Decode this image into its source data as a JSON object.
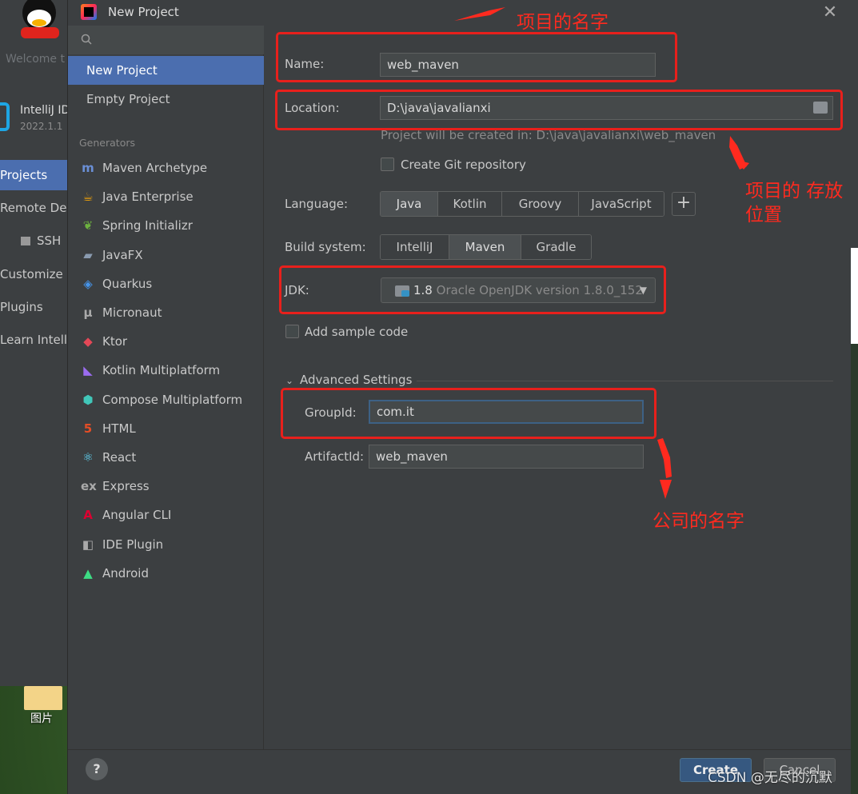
{
  "desktop": {
    "icon_label": "图片"
  },
  "welcome_window": {
    "title": "Welcome t",
    "app_name": "IntelliJ ID",
    "app_version": "2022.1.1",
    "nav": [
      {
        "label": "Projects",
        "selected": true
      },
      {
        "label": "Remote Dev",
        "selected": false
      },
      {
        "label": "SSH",
        "selected": false
      },
      {
        "label": "Customize",
        "selected": false
      },
      {
        "label": "Plugins",
        "selected": false
      },
      {
        "label": "Learn Intelli",
        "selected": false
      }
    ]
  },
  "dialog": {
    "title": "New Project",
    "close_glyph": "✕",
    "left_panel": {
      "search_placeholder": "",
      "items": [
        {
          "label": "New Project",
          "selected": true
        },
        {
          "label": "Empty Project",
          "selected": false
        }
      ],
      "generators_header": "Generators",
      "generators": [
        {
          "label": "Maven Archetype",
          "icon": "maven-icon",
          "glyph": "m",
          "color": "#6a8fd6"
        },
        {
          "label": "Java Enterprise",
          "icon": "java-enterprise-icon",
          "glyph": "☕",
          "color": "#f0a30a"
        },
        {
          "label": "Spring Initializr",
          "icon": "spring-icon",
          "glyph": "❦",
          "color": "#6db33f"
        },
        {
          "label": "JavaFX",
          "icon": "javafx-icon",
          "glyph": "▰",
          "color": "#8a9bb0"
        },
        {
          "label": "Quarkus",
          "icon": "quarkus-icon",
          "glyph": "◈",
          "color": "#4695eb"
        },
        {
          "label": "Micronaut",
          "icon": "micronaut-icon",
          "glyph": "μ",
          "color": "#aaaaaa"
        },
        {
          "label": "Ktor",
          "icon": "ktor-icon",
          "glyph": "◆",
          "color": "#e44857"
        },
        {
          "label": "Kotlin Multiplatform",
          "icon": "kotlin-icon",
          "glyph": "◣",
          "color": "#9b6cf0"
        },
        {
          "label": "Compose Multiplatform",
          "icon": "compose-icon",
          "glyph": "⬢",
          "color": "#41c7b9"
        },
        {
          "label": "HTML",
          "icon": "html-icon",
          "glyph": "5",
          "color": "#e44d26"
        },
        {
          "label": "React",
          "icon": "react-icon",
          "glyph": "⚛",
          "color": "#61dafb"
        },
        {
          "label": "Express",
          "icon": "express-icon",
          "glyph": "ex",
          "color": "#aaaaaa"
        },
        {
          "label": "Angular CLI",
          "icon": "angular-icon",
          "glyph": "A",
          "color": "#dd0031"
        },
        {
          "label": "IDE Plugin",
          "icon": "ide-plugin-icon",
          "glyph": "◧",
          "color": "#aaaaaa"
        },
        {
          "label": "Android",
          "icon": "android-icon",
          "glyph": "▲",
          "color": "#3ddc84"
        }
      ]
    },
    "form": {
      "name_label": "Name:",
      "name_value": "web_maven",
      "location_label": "Location:",
      "location_value": "D:\\java\\javalianxi",
      "location_hint": "Project will be created in: D:\\java\\javalianxi\\web_maven",
      "git_label": "Create Git repository",
      "git_checked": false,
      "language_label": "Language:",
      "languages": [
        {
          "label": "Java",
          "selected": true
        },
        {
          "label": "Kotlin",
          "selected": false
        },
        {
          "label": "Groovy",
          "selected": false
        },
        {
          "label": "JavaScript",
          "selected": false
        }
      ],
      "add_language_glyph": "+",
      "build_label": "Build system:",
      "build_systems": [
        {
          "label": "IntelliJ",
          "selected": false
        },
        {
          "label": "Maven",
          "selected": true
        },
        {
          "label": "Gradle",
          "selected": false
        }
      ],
      "jdk_label": "JDK:",
      "jdk_version": "1.8",
      "jdk_description": "Oracle OpenJDK version 1.8.0_152",
      "sample_code_label": "Add sample code",
      "sample_code_checked": false,
      "advanced_label": "Advanced Settings",
      "groupid_label": "GroupId:",
      "groupid_value": "com.it",
      "artifactid_label": "ArtifactId:",
      "artifactid_value": "web_maven"
    },
    "footer": {
      "help_label": "?",
      "create_label": "Create",
      "cancel_label": "Cancel"
    }
  },
  "annotations": {
    "project_name": "项目的名字",
    "project_location": "项目的 存放位置",
    "company_name": "公司的名字",
    "color": "#ff2a1f"
  },
  "watermark": "CSDN @无尽的沉默"
}
